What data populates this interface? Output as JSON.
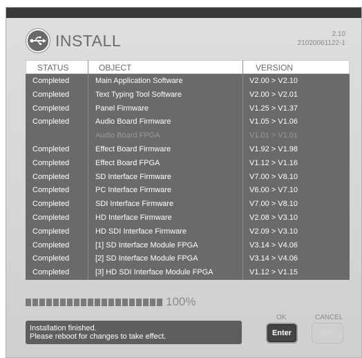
{
  "header": {
    "title": "INSTALL",
    "version_code": "2.10",
    "build_code": "21020061122-1"
  },
  "table": {
    "columns": [
      "STATUS",
      "OBJECT",
      "VERSION"
    ],
    "rows": [
      {
        "status": "Completed",
        "object": "Main Application Software",
        "version": "V2.00 > V2.10",
        "dim": false
      },
      {
        "status": "Completed",
        "object": "Text Typing Tool Software",
        "version": "V2.00 > V2.01",
        "dim": false
      },
      {
        "status": "Completed",
        "object": "Panel  Firmware",
        "version": "V1.25 > V1.37",
        "dim": false
      },
      {
        "status": "Completed",
        "object": "Audio  Board Firmware",
        "version": "V1.05 > V1.06",
        "dim": false
      },
      {
        "status": "",
        "object": "Audio  Board FPGA",
        "version": "V1.01 > V1.01",
        "dim": true
      },
      {
        "status": "Completed",
        "object": "Effect  Board Firmware",
        "version": "V1.92 > V1.98",
        "dim": false
      },
      {
        "status": "Completed",
        "object": "Effect  Board FPGA",
        "version": "V1.12 > V1.16",
        "dim": false
      },
      {
        "status": "Completed",
        "object": "SD  Interface  Firmware",
        "version": "V7.00 > V8.10",
        "dim": false
      },
      {
        "status": "Completed",
        "object": "PC  Interface  Firmware",
        "version": "V6.00 > V7.10",
        "dim": false
      },
      {
        "status": "Completed",
        "object": "SDI Interface   Firmware",
        "version": "V7.00 > V8.10",
        "dim": false
      },
      {
        "status": "Completed",
        "object": "HD Interface  Firmware",
        "version": "V2.08 > V3.10",
        "dim": false
      },
      {
        "status": "Completed",
        "object": "HD SDI Interface  Firmware",
        "version": "V2.09 > V3.10",
        "dim": false
      },
      {
        "status": "Completed",
        "object": "[1] SD Interface Module FPGA",
        "version": "V3.14 > V4.06",
        "dim": false
      },
      {
        "status": "Completed",
        "object": "[2] SD Interface Module FPGA",
        "version": "V3.14 > V4.06",
        "dim": false
      },
      {
        "status": "Completed",
        "object": "[3] HD SDI Interface Module FPGA",
        "version": "V1.12 > V1.15",
        "dim": false
      }
    ]
  },
  "progress": {
    "label": "100%",
    "value": 1.0,
    "segments": 20
  },
  "message": {
    "line1": "Installation finished.",
    "line2": "Please reboot for changes to take effect."
  },
  "buttons": {
    "ok_caption": "OK",
    "enter_label": "Enter",
    "cancel_caption": "CANCEL",
    "esc_label": "Esc"
  },
  "icons": {
    "header": "usb-icon"
  },
  "colors": {
    "table_bg": "#6a6a6a",
    "panel_bg": "#d6d6d6",
    "accent_dark": "#444444"
  }
}
